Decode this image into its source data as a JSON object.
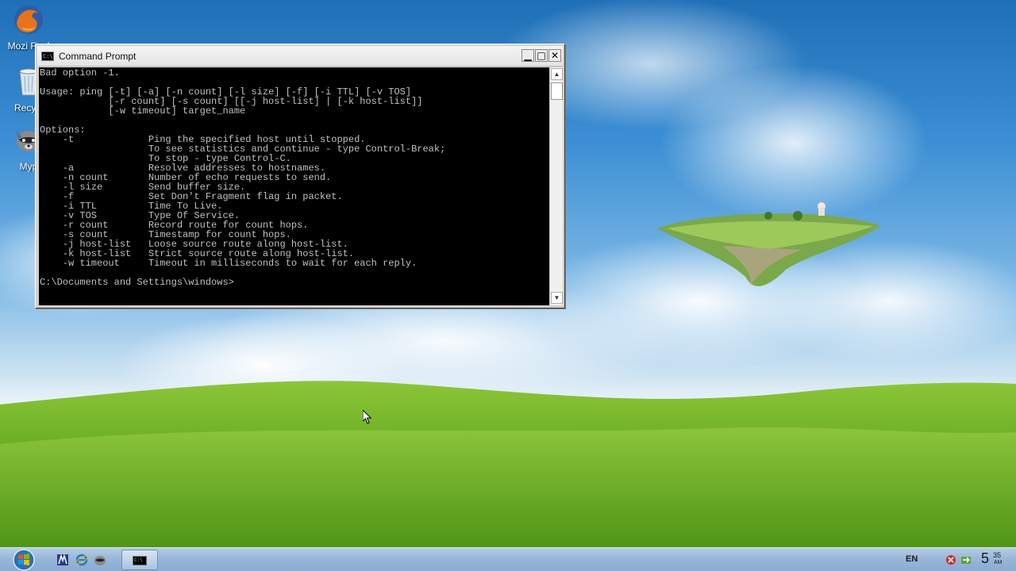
{
  "desktop": {
    "icons": [
      {
        "label": "Mozi Firef",
        "icon": "firefox-icon"
      },
      {
        "label": "Recycl",
        "icon": "recycle-bin-icon"
      },
      {
        "label": "Myp",
        "icon": "raccoon-icon"
      }
    ]
  },
  "window": {
    "title": "Command Prompt",
    "buttons": {
      "minimize": "▁",
      "maximize": "□",
      "close": "✕"
    },
    "console_lines": [
      "Bad option -1.",
      "",
      "Usage: ping [-t] [-a] [-n count] [-l size] [-f] [-i TTL] [-v TOS]",
      "            [-r count] [-s count] [[-j host-list] | [-k host-list]]",
      "            [-w timeout] target_name",
      "",
      "Options:",
      "    -t             Ping the specified host until stopped.",
      "                   To see statistics and continue - type Control-Break;",
      "                   To stop - type Control-C.",
      "    -a             Resolve addresses to hostnames.",
      "    -n count       Number of echo requests to send.",
      "    -l size        Send buffer size.",
      "    -f             Set Don't Fragment flag in packet.",
      "    -i TTL         Time To Live.",
      "    -v TOS         Type Of Service.",
      "    -r count       Record route for count hops.",
      "    -s count       Timestamp for count hops.",
      "    -j host-list   Loose source route along host-list.",
      "    -k host-list   Strict source route along host-list.",
      "    -w timeout     Timeout in milliseconds to wait for each reply.",
      "",
      "C:\\Documents and Settings\\windows>"
    ],
    "scroll_up": "▲",
    "scroll_down": "▼"
  },
  "taskbar": {
    "quicklaunch": [
      "app-icon",
      "internet-explorer-icon",
      "raccoon-icon"
    ],
    "task_icon_text": "C:\\",
    "language": "EN",
    "clock": {
      "hour": "5",
      "minute": "35",
      "ampm": "AM"
    }
  },
  "colors": {
    "console_bg": "#000000",
    "console_fg": "#c0c0c0",
    "taskbar": "#98b7d9"
  }
}
